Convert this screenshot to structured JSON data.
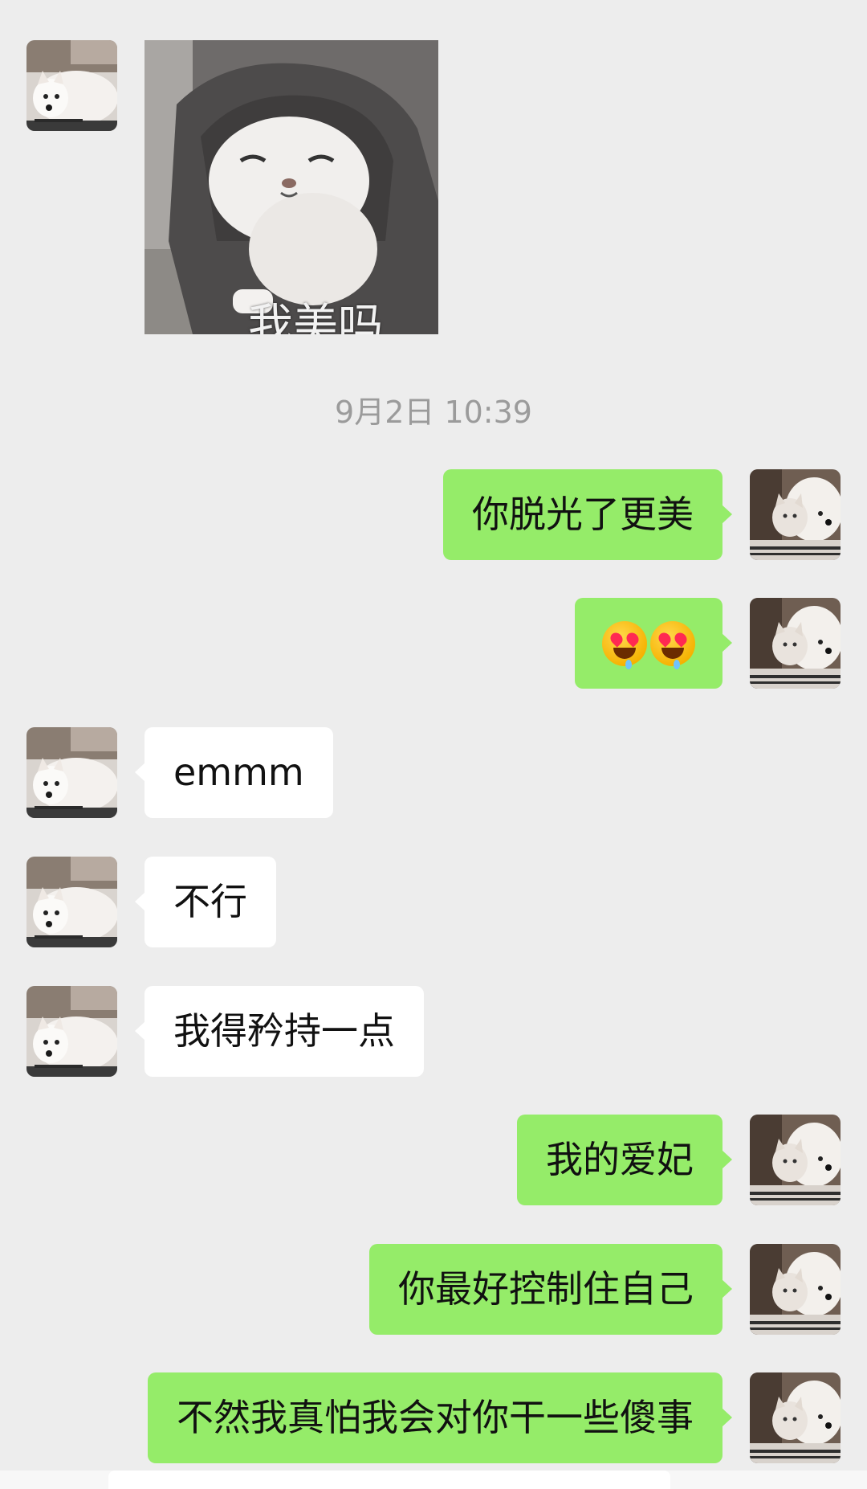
{
  "colors": {
    "background": "#ededed",
    "incoming_bubble": "#ffffff",
    "outgoing_bubble": "#95ec69",
    "timestamp_text": "#9b9b9b"
  },
  "sticker": {
    "caption": "我美吗",
    "icon": "cat-in-hoodie-sticker"
  },
  "timestamp": "9月2日 10:39",
  "messages": [
    {
      "direction": "out",
      "text": "你脱光了更美"
    },
    {
      "direction": "out",
      "text": "",
      "emoji": [
        "heart-eyes-drooling-emoji",
        "heart-eyes-drooling-emoji"
      ]
    },
    {
      "direction": "in",
      "text": "emmm"
    },
    {
      "direction": "in",
      "text": "不行"
    },
    {
      "direction": "in",
      "text": "我得矜持一点"
    },
    {
      "direction": "out",
      "text": "我的爱妃"
    },
    {
      "direction": "out",
      "text": "你最好控制住自己"
    },
    {
      "direction": "out",
      "text": "不然我真怕我会对你干一些傻事"
    }
  ],
  "avatars": {
    "incoming": "samoyed-dog-avatar",
    "outgoing": "cat-and-dog-avatar"
  }
}
